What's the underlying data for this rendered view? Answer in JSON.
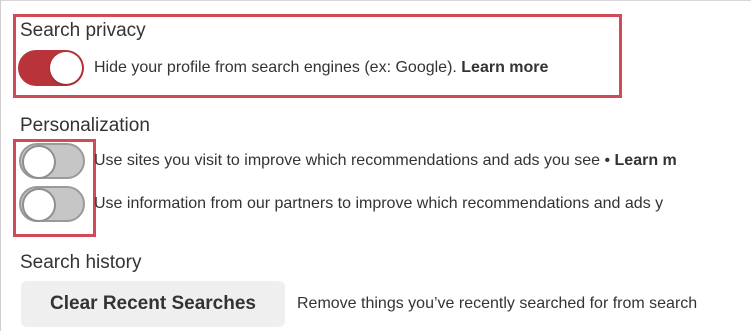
{
  "search_privacy": {
    "title": "Search privacy",
    "toggle_state": "on",
    "description": "Hide your profile from search engines (ex: Google).",
    "link": "Learn more"
  },
  "personalization": {
    "title": "Personalization",
    "items": [
      {
        "toggle_state": "off",
        "description": "Use sites you visit to improve which recommendations and ads you see •",
        "link": "Learn m"
      },
      {
        "toggle_state": "off",
        "description": "Use information from our partners to improve which recommendations and ads y",
        "link": ""
      }
    ]
  },
  "search_history": {
    "title": "Search history",
    "button_label": "Clear Recent Searches",
    "description": "Remove things you’ve recently searched for from search"
  },
  "colors": {
    "highlight": "#d2495a",
    "toggle_on": "#b8333a",
    "toggle_off": "#c6c6c6",
    "button_bg": "#efefef"
  }
}
